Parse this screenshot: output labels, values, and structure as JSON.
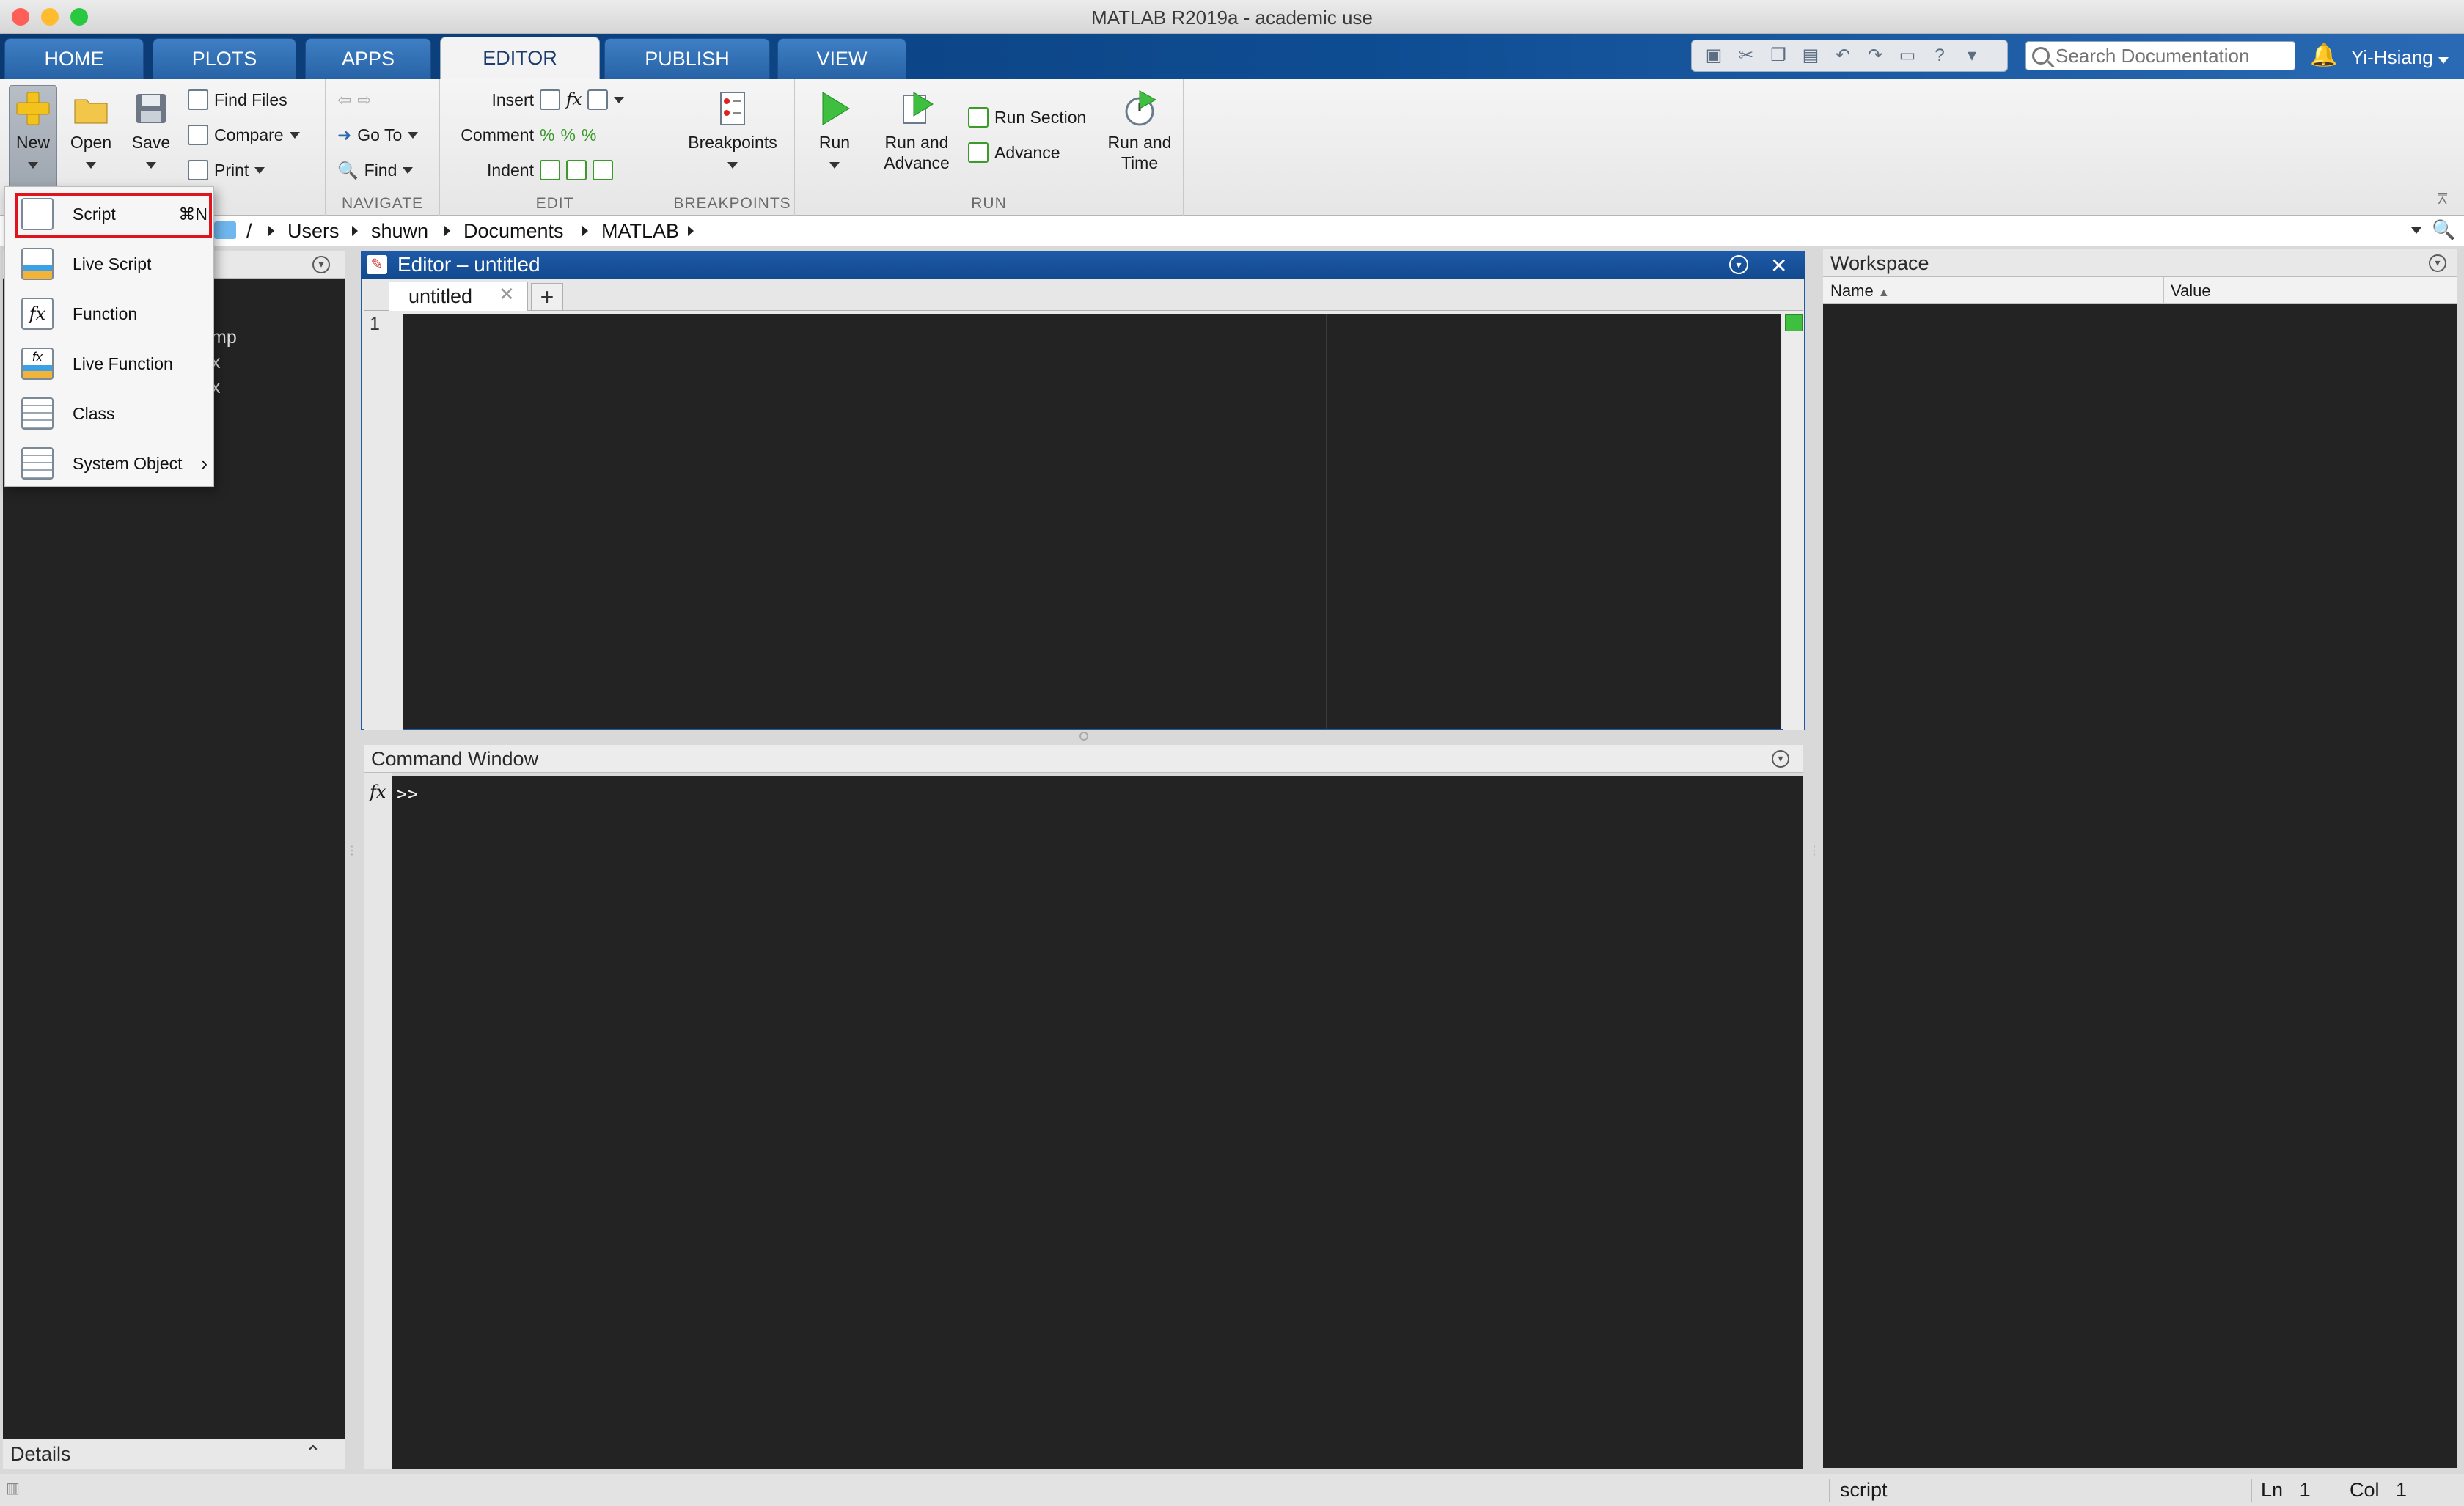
{
  "window": {
    "title": "MATLAB R2019a - academic use",
    "lights": {
      "close": "#ff5f57",
      "minimize": "#febc2e",
      "maximize": "#28c840"
    }
  },
  "main_tabs": [
    "HOME",
    "PLOTS",
    "APPS",
    "EDITOR",
    "PUBLISH",
    "VIEW"
  ],
  "active_tab": "EDITOR",
  "search": {
    "placeholder": "Search Documentation"
  },
  "user": {
    "name": "Yi-Hsiang"
  },
  "ribbon": {
    "file": {
      "new": "New",
      "open": "Open",
      "save": "Save",
      "find_files": "Find Files",
      "compare": "Compare",
      "print": "Print"
    },
    "navigate": {
      "label": "NAVIGATE",
      "go_to": "Go To",
      "find": "Find"
    },
    "edit": {
      "label": "EDIT",
      "insert": "Insert",
      "comment": "Comment",
      "indent": "Indent"
    },
    "breakpoints": {
      "label": "BREAKPOINTS",
      "breakpoints": "Breakpoints"
    },
    "run": {
      "label": "RUN",
      "run": "Run",
      "run_and_advance_1": "Run and",
      "run_and_advance_2": "Advance",
      "run_section": "Run Section",
      "advance": "Advance",
      "run_and_time_1": "Run and",
      "run_and_time_2": "Time"
    }
  },
  "path": {
    "root": "/",
    "crumbs": [
      "Users",
      "shuwn",
      "Documents",
      "MATLAB"
    ]
  },
  "new_menu": {
    "items": [
      {
        "label": "Script",
        "shortcut": "⌘N",
        "icon": "script-icon"
      },
      {
        "label": "Live Script",
        "icon": "live-script-icon"
      },
      {
        "label": "Function",
        "icon": "function-icon"
      },
      {
        "label": "Live Function",
        "icon": "live-function-icon"
      },
      {
        "label": "Class",
        "icon": "class-icon"
      },
      {
        "label": "System Object",
        "icon": "system-object-icon"
      }
    ]
  },
  "current_folder": {
    "partial": [
      "mp",
      "x",
      "x"
    ],
    "details": "Details"
  },
  "editor": {
    "title": "Editor – untitled",
    "tab": "untitled",
    "line_number": "1"
  },
  "command_window": {
    "title": "Command Window",
    "prompt": ">>"
  },
  "workspace": {
    "title": "Workspace",
    "col_name": "Name",
    "col_value": "Value"
  },
  "status": {
    "mode": "script",
    "ln_label": "Ln",
    "ln": "1",
    "col_label": "Col",
    "col": "1"
  },
  "colors": {
    "highlight": "#e0141e",
    "editor_bg": "#232323",
    "tab_blue": "#0e4c92"
  }
}
